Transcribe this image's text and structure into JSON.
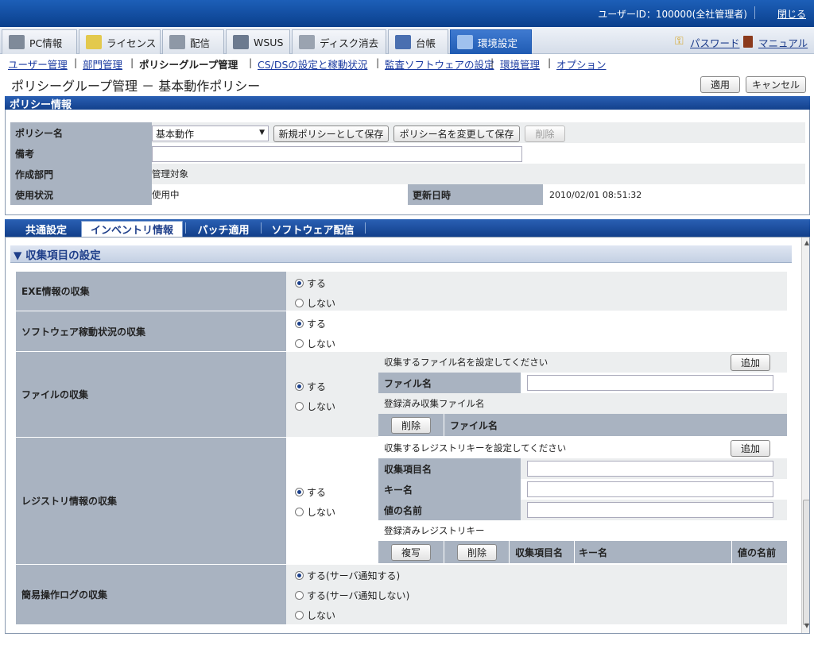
{
  "topbar": {
    "user_info": "ユーザーID：100000(全社管理者)",
    "close": "閉じる"
  },
  "mainnav": {
    "tabs": [
      {
        "label": "PC情報",
        "icon": "pc-icon"
      },
      {
        "label": "ライセンス",
        "icon": "license-icon"
      },
      {
        "label": "配信",
        "icon": "distribution-icon"
      },
      {
        "label": "WSUS",
        "icon": "wsus-icon"
      },
      {
        "label": "ディスク消去",
        "icon": "disk-erase-icon"
      },
      {
        "label": "台帳",
        "icon": "ledger-icon"
      },
      {
        "label": "環境設定",
        "icon": "settings-icon"
      }
    ],
    "password": "パスワード",
    "manual": "マニュアル"
  },
  "subnav": {
    "items": [
      "ユーザー管理",
      "部門管理",
      "ポリシーグループ管理",
      "CS/DSの設定と稼動状況",
      "監査ソフトウェアの設定",
      "環境管理",
      "オプション"
    ]
  },
  "page": {
    "title": "ポリシーグループ管理 － 基本動作ポリシー",
    "apply": "適用",
    "cancel": "キャンセル"
  },
  "policy": {
    "header": "ポリシー情報",
    "name_label": "ポリシー名",
    "name_value": "基本動作",
    "save_new": "新規ポリシーとして保存",
    "save_rename": "ポリシー名を変更して保存",
    "delete": "削除",
    "note_label": "備考",
    "dept_label": "作成部門",
    "dept_value": "管理対象",
    "status_label": "使用状況",
    "status_value": "使用中",
    "updated_label": "更新日時",
    "updated_value": "2010/02/01 08:51:32"
  },
  "tabs": [
    "共通設定",
    "インベントリ情報",
    "パッチ適用",
    "ソフトウェア配信"
  ],
  "section": {
    "title": "▼ 収集項目の設定"
  },
  "rows": {
    "exe": {
      "label": "EXE情報の収集",
      "yes": "する",
      "no": "しない"
    },
    "sw": {
      "label": "ソフトウェア稼動状況の収集",
      "yes": "する",
      "no": "しない"
    },
    "file": {
      "label": "ファイルの収集",
      "yes": "する",
      "no": "しない",
      "hint": "収集するファイル名を設定してください",
      "add": "追加",
      "filename_label": "ファイル名",
      "registered": "登録済み収集ファイル名",
      "delete": "削除",
      "col_filename": "ファイル名"
    },
    "reg": {
      "label": "レジストリ情報の収集",
      "yes": "する",
      "no": "しない",
      "hint": "収集するレジストリキーを設定してください",
      "add": "追加",
      "item_label": "収集項目名",
      "key_label": "キー名",
      "value_label": "値の名前",
      "registered": "登録済みレジストリキー",
      "copy": "複写",
      "delete": "削除",
      "col_item": "収集項目名",
      "col_key": "キー名",
      "col_value": "値の名前"
    },
    "oplog": {
      "label": "簡易操作ログの収集",
      "opt1": "する(サーバ通知する)",
      "opt2": "する(サーバ通知しない)",
      "opt3": "しない"
    }
  },
  "colors": {
    "nav_active": "#1f5bb3",
    "header_blue": "#123f8a",
    "label_gray": "#a9b3c1",
    "row_bg": "#eceeef"
  }
}
